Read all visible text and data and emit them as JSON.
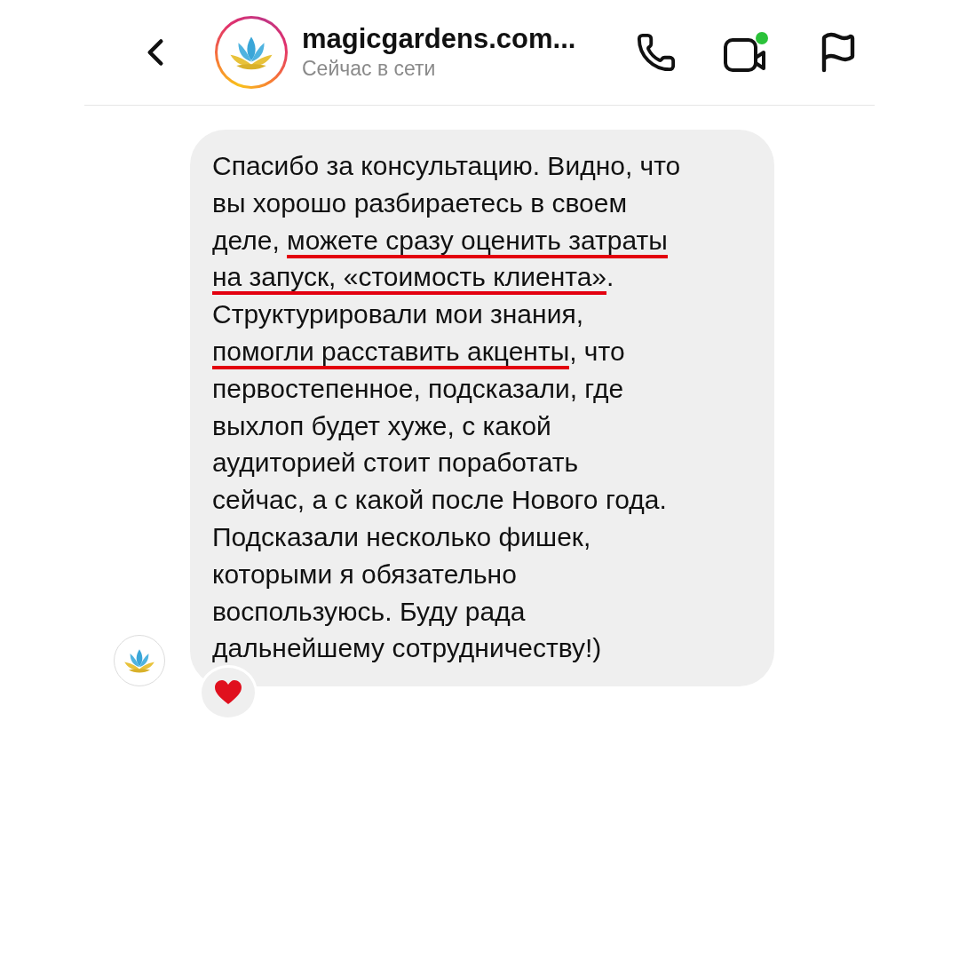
{
  "header": {
    "title": "magicgardens.com...",
    "status": "Сейчас в сети",
    "story_ring": true,
    "video_online": true
  },
  "message": {
    "lines": [
      [
        {
          "text": "Спасибо за консультацию. Видно, что",
          "underlined": false
        }
      ],
      [
        {
          "text": "вы хорошо разбираетесь в своем",
          "underlined": false
        }
      ],
      [
        {
          "text": "деле, ",
          "underlined": false
        },
        {
          "text": "можете сразу оценить затраты",
          "underlined": true
        }
      ],
      [
        {
          "text": "на запуск, «стоимость клиента»",
          "underlined": true
        },
        {
          "text": ".",
          "underlined": false
        }
      ],
      [
        {
          "text": "Структурировали мои знания,",
          "underlined": false
        }
      ],
      [
        {
          "text": "помогли расставить акценты",
          "underlined": true
        },
        {
          "text": ", что",
          "underlined": false
        }
      ],
      [
        {
          "text": "первостепенное, подсказали, где",
          "underlined": false
        }
      ],
      [
        {
          "text": "выхлоп будет хуже, с какой",
          "underlined": false
        }
      ],
      [
        {
          "text": "аудиторией стоит поработать",
          "underlined": false
        }
      ],
      [
        {
          "text": "сейчас, а с какой после Нового года.",
          "underlined": false
        }
      ],
      [
        {
          "text": "Подсказали несколько фишек,",
          "underlined": false
        }
      ],
      [
        {
          "text": "которыми я обязательно",
          "underlined": false
        }
      ],
      [
        {
          "text": "воспользуюсь. Буду рада",
          "underlined": false
        }
      ],
      [
        {
          "text": "дальнейшему сотрудничеству!)",
          "underlined": false
        }
      ]
    ],
    "reaction": {
      "kind": "heart"
    }
  }
}
